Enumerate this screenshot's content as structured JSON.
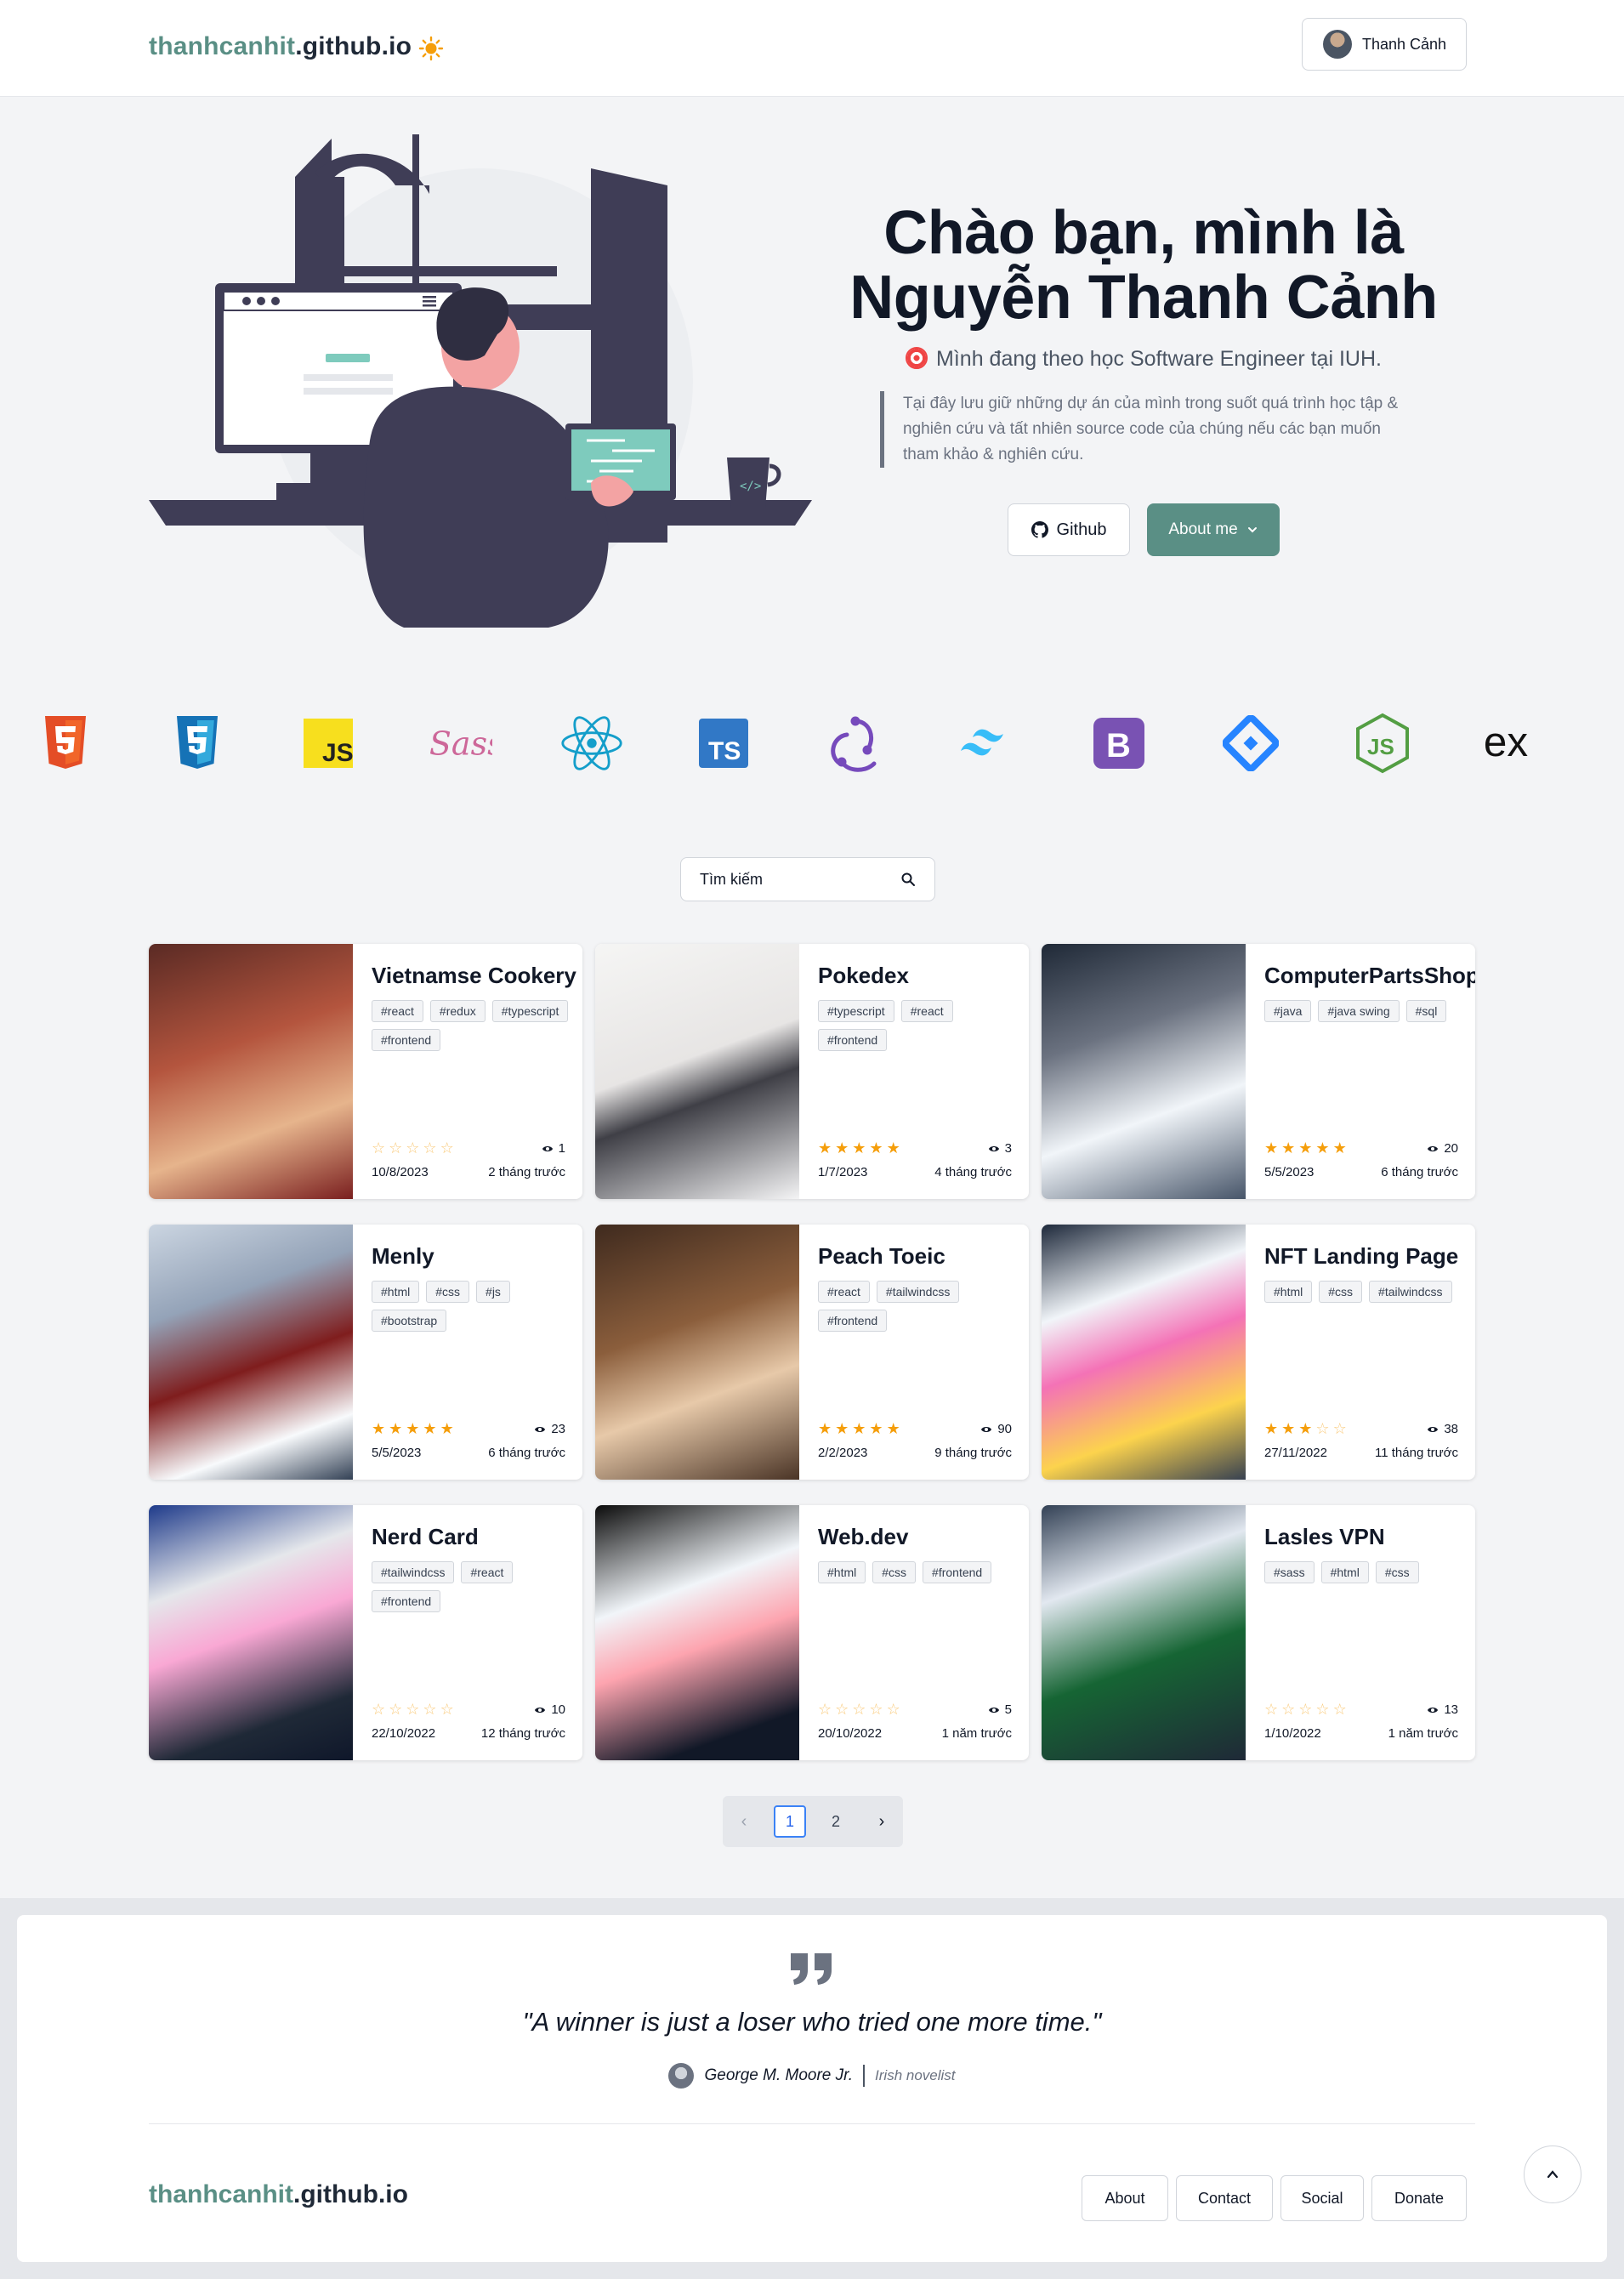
{
  "header": {
    "logo_brand": "thanhcanhit",
    "logo_tld": ".github.io",
    "theme_icon": "sun-icon",
    "user_name": "Thanh Cảnh"
  },
  "hero": {
    "title_line1": "Chào bạn, mình là",
    "title_line2": "Nguyễn Thanh Cảnh",
    "subtitle": "Mình đang theo học Software Engineer tại IUH.",
    "description": "Tại đây lưu giữ những dự án của mình trong suốt quá trình học tập & nghiên cứu và tất nhiên source code của chúng nếu các bạn muốn tham khảo & nghiên cứu.",
    "github_label": "Github",
    "about_label": "About me"
  },
  "tech_stack": [
    {
      "name": "html5-icon",
      "color": "#e44d26"
    },
    {
      "name": "css3-icon",
      "color": "#1572b6"
    },
    {
      "name": "javascript-icon",
      "color": "#f7df1e"
    },
    {
      "name": "sass-icon",
      "color": "#cd6799"
    },
    {
      "name": "react-icon",
      "color": "#149eca"
    },
    {
      "name": "typescript-icon",
      "color": "#3178c6"
    },
    {
      "name": "redux-icon",
      "color": "#764abc"
    },
    {
      "name": "tailwindcss-icon",
      "color": "#38bdf8"
    },
    {
      "name": "bootstrap-icon",
      "color": "#7952b3"
    },
    {
      "name": "jira-icon",
      "color": "#2684ff"
    },
    {
      "name": "nodejs-icon",
      "color": "#539e43"
    },
    {
      "name": "express-icon",
      "color": "#111111"
    }
  ],
  "search": {
    "placeholder": "Tìm kiếm"
  },
  "projects": [
    {
      "title": "Vietnamse Cookery",
      "tags": [
        "#react",
        "#redux",
        "#typescript",
        "#frontend"
      ],
      "rating": 0,
      "views": "1",
      "date": "10/8/2023",
      "ago": "2 tháng trước"
    },
    {
      "title": "Pokedex",
      "tags": [
        "#typescript",
        "#react",
        "#frontend"
      ],
      "rating": 5,
      "views": "3",
      "date": "1/7/2023",
      "ago": "4 tháng trước"
    },
    {
      "title": "ComputerPartsShop",
      "tags": [
        "#java",
        "#java swing",
        "#sql"
      ],
      "rating": 5,
      "views": "20",
      "date": "5/5/2023",
      "ago": "6 tháng trước"
    },
    {
      "title": "Menly",
      "tags": [
        "#html",
        "#css",
        "#js",
        "#bootstrap"
      ],
      "rating": 5,
      "views": "23",
      "date": "5/5/2023",
      "ago": "6 tháng trước"
    },
    {
      "title": "Peach Toeic",
      "tags": [
        "#react",
        "#tailwindcss",
        "#frontend"
      ],
      "rating": 5,
      "views": "90",
      "date": "2/2/2023",
      "ago": "9 tháng trước"
    },
    {
      "title": "NFT Landing Page",
      "tags": [
        "#html",
        "#css",
        "#tailwindcss"
      ],
      "rating": 2.5,
      "views": "38",
      "date": "27/11/2022",
      "ago": "11 tháng trước"
    },
    {
      "title": "Nerd Card",
      "tags": [
        "#tailwindcss",
        "#react",
        "#frontend"
      ],
      "rating": 0,
      "views": "10",
      "date": "22/10/2022",
      "ago": "12 tháng trước"
    },
    {
      "title": "Web.dev",
      "tags": [
        "#html",
        "#css",
        "#frontend"
      ],
      "rating": 0,
      "views": "5",
      "date": "20/10/2022",
      "ago": "1 năm trước"
    },
    {
      "title": "Lasles VPN",
      "tags": [
        "#sass",
        "#html",
        "#css"
      ],
      "rating": 0,
      "views": "13",
      "date": "1/10/2022",
      "ago": "1 năm trước"
    }
  ],
  "pagination": {
    "pages": [
      "1",
      "2"
    ],
    "current": "1",
    "prev": "‹",
    "next": "›"
  },
  "footer": {
    "quote": "\"A winner is just a loser who tried one more time.\"",
    "author": "George M. Moore Jr.",
    "author_role": "Irish novelist",
    "logo_brand": "thanhcanhit",
    "logo_tld": ".github.io",
    "links": [
      "About",
      "Contact",
      "Social",
      "Donate"
    ]
  },
  "colors": {
    "accent": "#5a8f85",
    "background": "#f3f4f6",
    "star": "#f59e0b"
  }
}
